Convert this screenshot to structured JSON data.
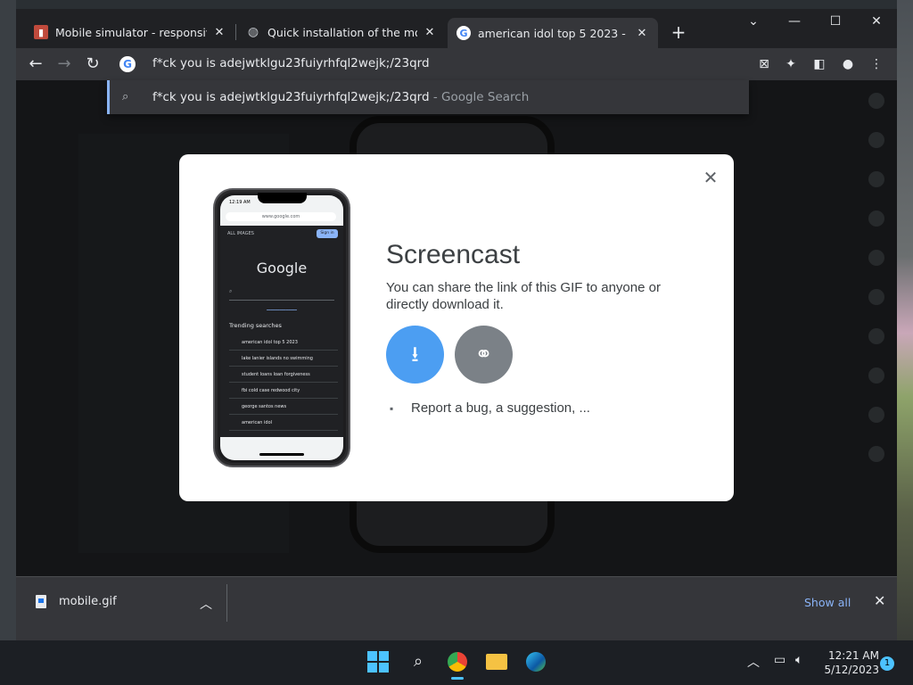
{
  "browser": {
    "tabs": [
      {
        "title": "Mobile simulator - responsive te",
        "favicon": "mobile-simulator-favicon",
        "active": false
      },
      {
        "title": "Quick installation of the mobile s",
        "favicon": "globe-favicon",
        "active": false
      },
      {
        "title": "american idol top 5 2023 - Goog",
        "favicon": "google-favicon",
        "active": true
      }
    ],
    "new_tab_label": "+",
    "omnibox_text": "f*ck you is adejwtklgu23fuiyrhfql2wejk;/23qrd",
    "suggestion": {
      "query": "f*ck you is adejwtklgu23fuiyrhfql2wejk;/23qrd",
      "suffix": " - Google Search"
    }
  },
  "modal": {
    "title": "Screencast",
    "description": "You can share the link of this GIF to anyone or directly download it.",
    "report_label": "Report a bug, a suggestion, ...",
    "download_icon": "download-icon",
    "link_icon": "link-icon",
    "preview": {
      "time": "12:19 AM",
      "url": "www.google.com",
      "tabs": "ALL   IMAGES",
      "signin": "Sign in",
      "logo": "Google",
      "trending_header": "Trending searches",
      "trending": [
        "american idol top 5 2023",
        "lake lanier islands no swimming",
        "student loans loan forgiveness",
        "fbi cold case redwood city",
        "george santos news",
        "american idol"
      ]
    }
  },
  "downloads": {
    "file_name": "mobile.gif",
    "show_all": "Show all"
  },
  "taskbar": {
    "time": "12:21 AM",
    "date": "5/12/2023",
    "notification_count": "1"
  }
}
